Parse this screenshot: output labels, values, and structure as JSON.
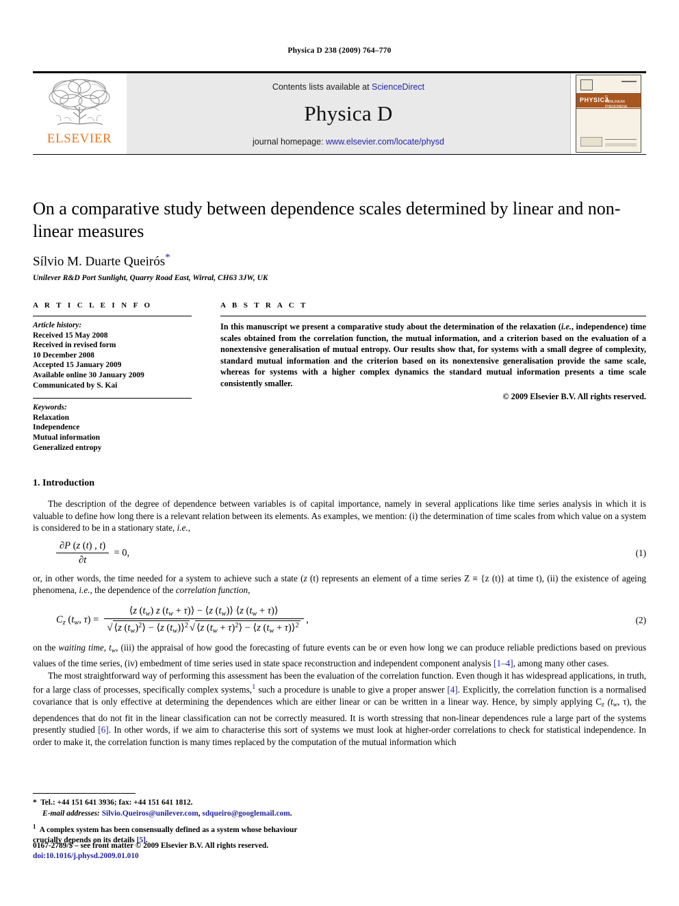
{
  "running_head": "Physica D 238 (2009) 764–770",
  "masthead": {
    "publisher_logo_text": "ELSEVIER",
    "contents_prefix": "Contents lists available at ",
    "contents_link": "ScienceDirect",
    "journal_name": "Physica D",
    "homepage_prefix": "journal homepage: ",
    "homepage_link": "www.elsevier.com/locate/physd",
    "cover": {
      "band_title": "PHYSICA",
      "band_sub_line1": "D",
      "band_sub_line2": "NONLINEAR PHENOMENA"
    }
  },
  "article": {
    "title": "On a comparative study between dependence scales determined by linear and non-linear measures",
    "author": "Sílvio M. Duarte Queirós",
    "author_marker": "*",
    "affiliation": "Unilever R&D Port Sunlight, Quarry Road East, Wirral, CH63 3JW, UK"
  },
  "article_info": {
    "heading": "A R T I C L E    I N F O",
    "history_label": "Article history:",
    "history": [
      "Received 15 May 2008",
      "Received in revised form",
      "10 December 2008",
      "Accepted 15 January 2009",
      "Available online 30 January 2009",
      "Communicated by S. Kai"
    ],
    "keywords_label": "Keywords:",
    "keywords": [
      "Relaxation",
      "Independence",
      "Mutual information",
      "Generalized entropy"
    ]
  },
  "abstract": {
    "heading": "A B S T R A C T",
    "text_part1": "In this manuscript we present a comparative study about the determination of the relaxation (",
    "text_ie": "i.e.",
    "text_part2": ", independence) time scales obtained from the correlation function, the mutual information, and a criterion based on the evaluation of a nonextensive generalisation of mutual entropy. Our results show that, for systems with a small degree of complexity, standard mutual information and the criterion based on its nonextensive generalisation provide the same scale, whereas for systems with a higher complex dynamics the standard mutual information presents a time scale consistently smaller.",
    "copyright": "© 2009 Elsevier B.V. All rights reserved."
  },
  "body": {
    "section_heading": "1. Introduction",
    "p1_a": "The description of the degree of dependence between variables is of capital importance, namely in several applications like time series analysis in which it is valuable to define how long there is a relevant relation between its elements. As examples, we mention: (i) the determination of time scales from which value on a system is considered to be in a stationary state, ",
    "p1_ie": "i.e.",
    "p1_b": ",",
    "eq1_number": "(1)",
    "between_a": "or, in other words, the time needed for a system to achieve such a state (",
    "between_z": "z",
    "between_b": " (t) represents an element of a time series Z ≡ {z (t)} at time t), (ii) the existence of ageing phenomena, ",
    "between_ie": "i.e.",
    "between_c": ", the dependence of the ",
    "between_cf": "correlation function",
    "between_d": ",",
    "eq2_number": "(2)",
    "p2_a": "on the ",
    "p2_wt": "waiting time",
    "p2_b": ", t",
    "p2_w": "w",
    "p2_c": ", (iii) the appraisal of how good the forecasting of future events can be or even how long we can produce reliable predictions based on previous values of the time series, (iv) embedment of time series used in state space reconstruction and independent component analysis ",
    "p2_ref": "[1–4]",
    "p2_d": ", among many other cases.",
    "p3_a": "The most straightforward way of performing this assessment has been the evaluation of the correlation function. Even though it has widespread applications, in truth, for a large class of processes, specifically complex systems,",
    "p3_fn": "1",
    "p3_b": " such a procedure is unable to give a proper answer ",
    "p3_ref1": "[4]",
    "p3_c": ". Explicitly, the correlation function is a normalised covariance that is only effective at determining the dependences which are either linear or can be written in a linear way. Hence, by simply applying C",
    "p3_cz": "z",
    "p3_d": " (t",
    "p3_tw": "w",
    "p3_e": ", τ), the dependences that do not fit in the linear classification can not be correctly measured. It is worth stressing that non-linear dependences rule a large part of the systems presently studied ",
    "p3_ref2": "[6]",
    "p3_f": ". In other words, if we aim to characterise this sort of systems we must look at higher-order correlations to check for statistical independence. In order to make it, the correlation function is many times replaced by the computation of the mutual information which"
  },
  "footnotes": {
    "star_mark": "*",
    "tel_text": "Tel.: +44 151 641 3936; fax: +44 151 641 1812.",
    "email_label": "E-mail addresses:",
    "email1": "Silvio.Queiros@unilever.com",
    "email_sep": ", ",
    "email2": "sdqueiro@googlemail.com",
    "email_end": ".",
    "fn1_mark": "1",
    "fn1_text_a": "A complex system has been consensually defined as a system whose behaviour crucially depends on its details ",
    "fn1_ref": "[5]",
    "fn1_text_b": "."
  },
  "imprint": {
    "issn_line": "0167-2789/$ – see front matter © 2009 Elsevier B.V. All rights reserved.",
    "doi_line": "doi:10.1016/j.physd.2009.01.010"
  },
  "colors": {
    "link_blue": "#2323a8",
    "elsevier_orange": "#E87722",
    "masthead_grey": "#e9e9e9",
    "cover_band": "#a8561f"
  }
}
